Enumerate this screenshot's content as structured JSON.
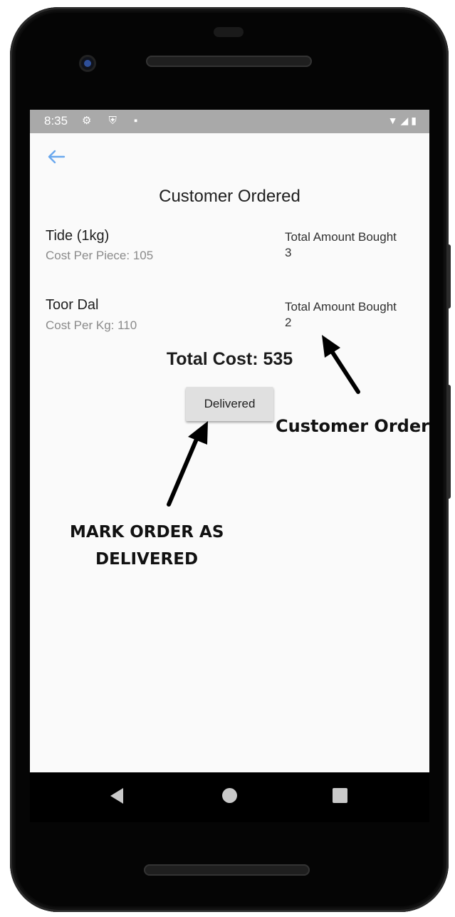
{
  "status_bar": {
    "time": "8:35",
    "left_icons": "⚙ ⛨ ▪",
    "right_icons": "▼◢▮"
  },
  "app": {
    "title": "Customer Ordered",
    "back_icon": "arrow-left"
  },
  "order_items": [
    {
      "name": "Tide (1kg)",
      "cost_text": "Cost Per Piece: 105",
      "amount_label": "Total Amount Bought",
      "amount": "3"
    },
    {
      "name": "Toor Dal",
      "cost_text": "Cost Per Kg: 110",
      "amount_label": "Total Amount Bought",
      "amount": "2"
    }
  ],
  "total": "Total Cost: 535",
  "delivered_button": "Delivered",
  "annotations": {
    "customer_order": "Customer Order",
    "mark_line1": "MARK ORDER AS",
    "mark_line2": "DELIVERED"
  },
  "colors": {
    "status_bar": "#a9a9a9",
    "back_arrow": "#6aa8ee",
    "button_bg": "#e0e0e0"
  }
}
